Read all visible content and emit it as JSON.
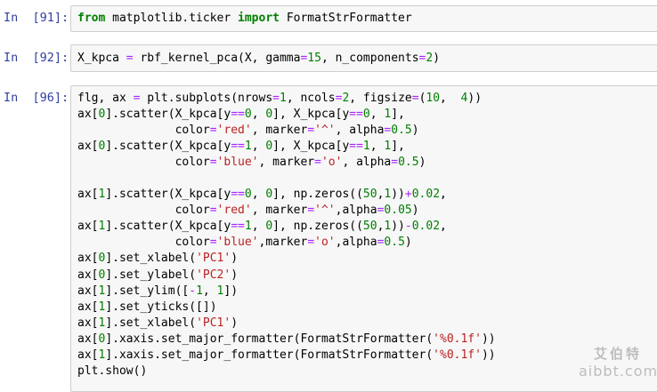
{
  "cells": [
    {
      "prompt": "In  [91]:",
      "tokens": [
        [
          [
            "kw",
            "from"
          ],
          [
            "t",
            " matplotlib.ticker "
          ],
          [
            "kw",
            "import"
          ],
          [
            "t",
            " FormatStrFormatter"
          ]
        ]
      ]
    },
    {
      "prompt": "In  [92]:",
      "tokens": [
        [
          [
            "t",
            "X_kpca "
          ],
          [
            "op",
            "="
          ],
          [
            "t",
            " rbf_kernel_pca(X, gamma"
          ],
          [
            "op",
            "="
          ],
          [
            "num",
            "15"
          ],
          [
            "t",
            ", n_components"
          ],
          [
            "op",
            "="
          ],
          [
            "num",
            "2"
          ],
          [
            "t",
            ")"
          ]
        ]
      ]
    },
    {
      "prompt": "In  [96]:",
      "tokens": [
        [
          [
            "t",
            "flg, ax "
          ],
          [
            "op",
            "="
          ],
          [
            "t",
            " plt.subplots(nrows"
          ],
          [
            "op",
            "="
          ],
          [
            "num",
            "1"
          ],
          [
            "t",
            ", ncols"
          ],
          [
            "op",
            "="
          ],
          [
            "num",
            "2"
          ],
          [
            "t",
            ", figsize"
          ],
          [
            "op",
            "="
          ],
          [
            "t",
            "("
          ],
          [
            "num",
            "10"
          ],
          [
            "t",
            ",  "
          ],
          [
            "num",
            "4"
          ],
          [
            "t",
            ")"
          ],
          [
            "t",
            ")"
          ]
        ],
        [
          [
            "t",
            "ax["
          ],
          [
            "num",
            "0"
          ],
          [
            "t",
            "].scatter(X_kpca[y"
          ],
          [
            "op",
            "=="
          ],
          [
            "num",
            "0"
          ],
          [
            "t",
            ", "
          ],
          [
            "num",
            "0"
          ],
          [
            "t",
            "], X_kpca[y"
          ],
          [
            "op",
            "=="
          ],
          [
            "num",
            "0"
          ],
          [
            "t",
            ", "
          ],
          [
            "num",
            "1"
          ],
          [
            "t",
            "],"
          ]
        ],
        [
          [
            "t",
            "              color"
          ],
          [
            "op",
            "="
          ],
          [
            "str",
            "'red'"
          ],
          [
            "t",
            ", marker"
          ],
          [
            "op",
            "="
          ],
          [
            "str",
            "'^'"
          ],
          [
            "t",
            ", alpha"
          ],
          [
            "op",
            "="
          ],
          [
            "num",
            "0.5"
          ],
          [
            "t",
            ")"
          ]
        ],
        [
          [
            "t",
            "ax["
          ],
          [
            "num",
            "0"
          ],
          [
            "t",
            "].scatter(X_kpca[y"
          ],
          [
            "op",
            "=="
          ],
          [
            "num",
            "1"
          ],
          [
            "t",
            ", "
          ],
          [
            "num",
            "0"
          ],
          [
            "t",
            "], X_kpca[y"
          ],
          [
            "op",
            "=="
          ],
          [
            "num",
            "1"
          ],
          [
            "t",
            ", "
          ],
          [
            "num",
            "1"
          ],
          [
            "t",
            "],"
          ]
        ],
        [
          [
            "t",
            "              color"
          ],
          [
            "op",
            "="
          ],
          [
            "str",
            "'blue'"
          ],
          [
            "t",
            ", marker"
          ],
          [
            "op",
            "="
          ],
          [
            "str",
            "'o'"
          ],
          [
            "t",
            ", alpha"
          ],
          [
            "op",
            "="
          ],
          [
            "num",
            "0.5"
          ],
          [
            "t",
            ")"
          ]
        ],
        [
          [
            "t",
            ""
          ]
        ],
        [
          [
            "t",
            "ax["
          ],
          [
            "num",
            "1"
          ],
          [
            "t",
            "].scatter(X_kpca[y"
          ],
          [
            "op",
            "=="
          ],
          [
            "num",
            "0"
          ],
          [
            "t",
            ", "
          ],
          [
            "num",
            "0"
          ],
          [
            "t",
            "], np.zeros(("
          ],
          [
            "num",
            "50"
          ],
          [
            "t",
            ","
          ],
          [
            "num",
            "1"
          ],
          [
            "t",
            "))"
          ],
          [
            "op",
            "+"
          ],
          [
            "num",
            "0.02"
          ],
          [
            "t",
            ","
          ]
        ],
        [
          [
            "t",
            "              color"
          ],
          [
            "op",
            "="
          ],
          [
            "str",
            "'red'"
          ],
          [
            "t",
            ", marker"
          ],
          [
            "op",
            "="
          ],
          [
            "str",
            "'^'"
          ],
          [
            "t",
            ",alpha"
          ],
          [
            "op",
            "="
          ],
          [
            "num",
            "0.05"
          ],
          [
            "t",
            ")"
          ]
        ],
        [
          [
            "t",
            "ax["
          ],
          [
            "num",
            "1"
          ],
          [
            "t",
            "].scatter(X_kpca[y"
          ],
          [
            "op",
            "=="
          ],
          [
            "num",
            "1"
          ],
          [
            "t",
            ", "
          ],
          [
            "num",
            "0"
          ],
          [
            "t",
            "], np.zeros(("
          ],
          [
            "num",
            "50"
          ],
          [
            "t",
            ","
          ],
          [
            "num",
            "1"
          ],
          [
            "t",
            "))"
          ],
          [
            "op",
            "-"
          ],
          [
            "num",
            "0.02"
          ],
          [
            "t",
            ","
          ]
        ],
        [
          [
            "t",
            "              color"
          ],
          [
            "op",
            "="
          ],
          [
            "str",
            "'blue'"
          ],
          [
            "t",
            ",marker"
          ],
          [
            "op",
            "="
          ],
          [
            "str",
            "'o'"
          ],
          [
            "t",
            ",alpha"
          ],
          [
            "op",
            "="
          ],
          [
            "num",
            "0.5"
          ],
          [
            "t",
            ")"
          ]
        ],
        [
          [
            "t",
            "ax["
          ],
          [
            "num",
            "0"
          ],
          [
            "t",
            "].set_xlabel("
          ],
          [
            "str",
            "'PC1'"
          ],
          [
            "t",
            ")"
          ]
        ],
        [
          [
            "t",
            "ax["
          ],
          [
            "num",
            "0"
          ],
          [
            "t",
            "].set_ylabel("
          ],
          [
            "str",
            "'PC2'"
          ],
          [
            "t",
            ")"
          ]
        ],
        [
          [
            "t",
            "ax["
          ],
          [
            "num",
            "1"
          ],
          [
            "t",
            "].set_ylim(["
          ],
          [
            "op",
            "-"
          ],
          [
            "num",
            "1"
          ],
          [
            "t",
            ", "
          ],
          [
            "num",
            "1"
          ],
          [
            "t",
            "])"
          ]
        ],
        [
          [
            "t",
            "ax["
          ],
          [
            "num",
            "1"
          ],
          [
            "t",
            "].set_yticks([])"
          ]
        ],
        [
          [
            "t",
            "ax["
          ],
          [
            "num",
            "1"
          ],
          [
            "t",
            "].set_xlabel("
          ],
          [
            "str",
            "'PC1'"
          ],
          [
            "t",
            ")"
          ]
        ],
        [
          [
            "t",
            "ax["
          ],
          [
            "num",
            "0"
          ],
          [
            "t",
            "].xaxis.set_major_formatter(FormatStrFormatter("
          ],
          [
            "str",
            "'%0.1f'"
          ],
          [
            "t",
            "))"
          ]
        ],
        [
          [
            "t",
            "ax["
          ],
          [
            "num",
            "1"
          ],
          [
            "t",
            "].xaxis.set_major_formatter(FormatStrFormatter("
          ],
          [
            "str",
            "'%0.1f'"
          ],
          [
            "t",
            "))"
          ]
        ],
        [
          [
            "t",
            "plt.show()"
          ]
        ]
      ]
    }
  ],
  "watermark": {
    "top": "艾伯特",
    "bottom": "aibbt.com"
  }
}
